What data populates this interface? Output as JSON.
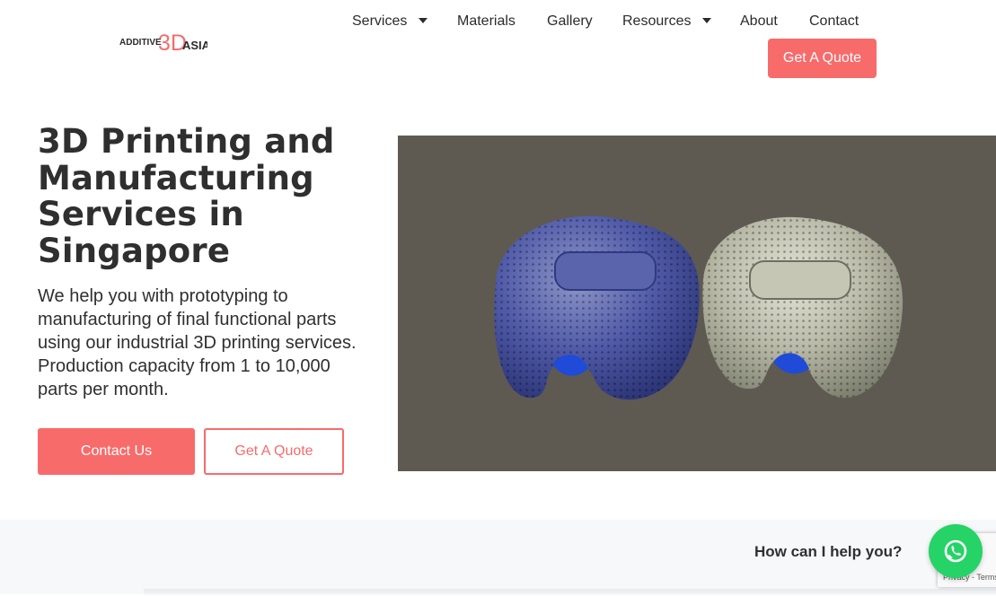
{
  "logo": {
    "text_left": "ADDITIVE",
    "text_mid": "3D",
    "text_right": "ASIA"
  },
  "nav": {
    "services": "Services",
    "materials": "Materials",
    "gallery": "Gallery",
    "resources": "Resources",
    "about": "About",
    "contact": "Contact",
    "get_quote": "Get A Quote"
  },
  "hero": {
    "title": "3D Printing and Manufacturing Services in Singapore",
    "description": "We help you with prototyping to manufacturing of final functional parts using our industrial 3D printing services. Production capacity from 1 to 10,000 parts per month.",
    "contact_button": "Contact Us",
    "quote_button": "Get A Quote"
  },
  "help": {
    "text": "How can I help you?"
  },
  "recaptcha": {
    "label": "Privacy - Terms"
  },
  "colors": {
    "accent": "#f86b6b",
    "image_bg": "#5e5a52",
    "whatsapp": "#25d366"
  }
}
